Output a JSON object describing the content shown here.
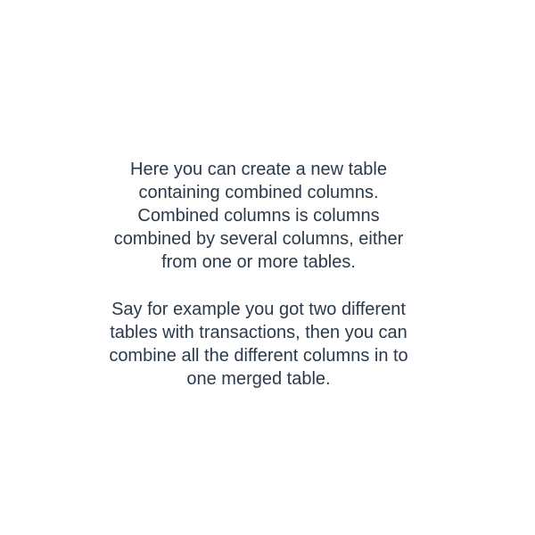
{
  "intro": {
    "paragraph_1": [
      "Here you can create a new table",
      "containing combined columns.",
      "Combined columns is columns",
      "combined by several columns, either",
      "from one or more tables."
    ],
    "paragraph_2": [
      "Say for example you got two different",
      "tables with transactions, then you can",
      "combine all the different columns in to",
      "one merged table."
    ]
  }
}
